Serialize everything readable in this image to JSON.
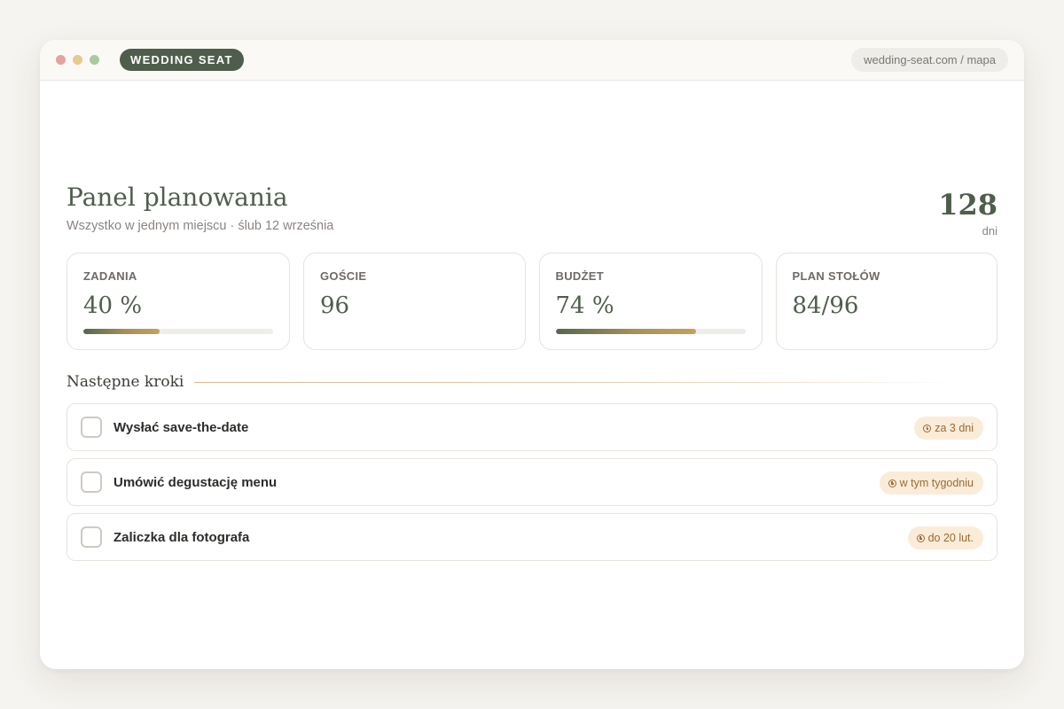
{
  "app": {
    "brand": "WEDDING SEAT",
    "url": "wedding-seat.com / mapa"
  },
  "header": {
    "title": "Panel planowania",
    "subtitle": "Wszystko w jednym miejscu · ślub 12 września",
    "days_count": "128",
    "days_label": "dni"
  },
  "stats": [
    {
      "label": "ZADANIA",
      "value": "40 %",
      "progress": 0.4
    },
    {
      "label": "GOŚCIE",
      "value": "96"
    },
    {
      "label": "BUDŻET",
      "value": "74 %",
      "progress": 0.74
    },
    {
      "label": "PLAN STOŁÓW",
      "value": "84/96"
    }
  ],
  "next_steps": {
    "title": "Następne kroki",
    "tasks": [
      {
        "label": "Wysłać save-the-date",
        "due": "za 3 dni",
        "done": false
      },
      {
        "label": "Umówić degustację menu",
        "due": "w tym tygodniu",
        "done": false
      },
      {
        "label": "Zaliczka dla fotografa",
        "due": "do 20 lut.",
        "done": false
      }
    ]
  },
  "colors": {
    "accent_green": "#4f5e4c",
    "due_badge_bg": "#fbecd9",
    "due_badge_text": "#9b6a2f"
  },
  "icons": [
    "clock-icon"
  ]
}
